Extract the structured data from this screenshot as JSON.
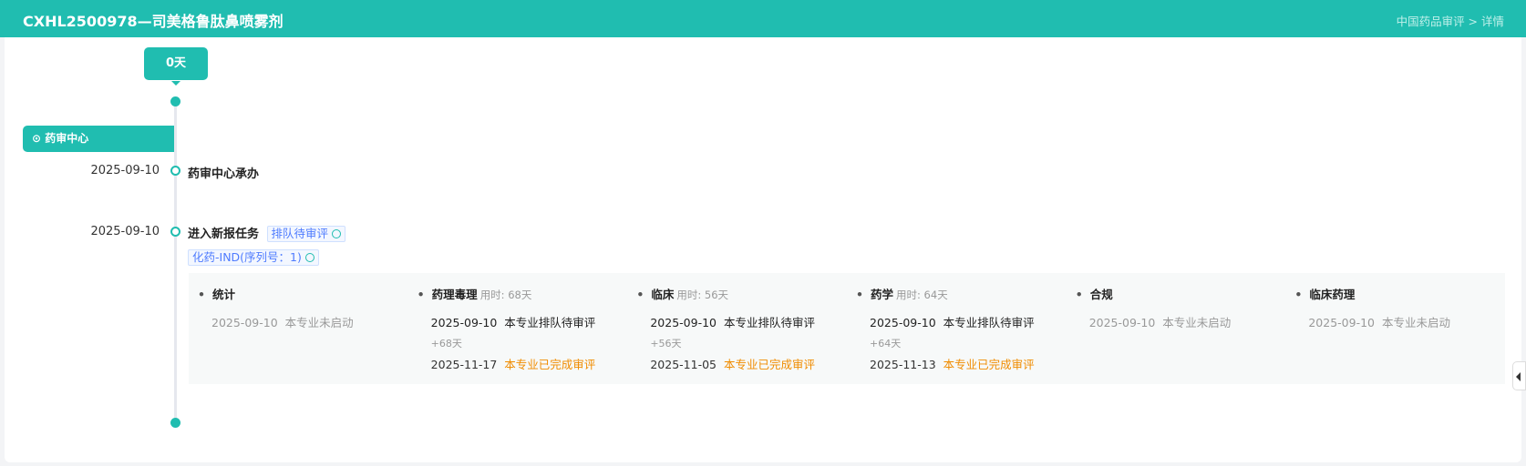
{
  "header": {
    "title": "CXHL2500978—司美格鲁肽鼻喷雾剂",
    "breadcrumb": "中国药品审评 > 详情"
  },
  "timeline": {
    "days": "0天",
    "location": "药审中心",
    "events": [
      {
        "date": "2025-09-10",
        "title": "药审中心承办"
      },
      {
        "date": "2025-09-10",
        "title": "进入新报任务",
        "tag": "排队待审评",
        "sub_tag": "化药-IND(序列号：1)"
      }
    ]
  },
  "specialties": [
    {
      "name": "统计",
      "used": "",
      "lines": [
        {
          "date": "2025-09-10",
          "status": "本专业未启动"
        }
      ]
    },
    {
      "name": "药理毒理",
      "used": "用时: 68天",
      "lines": [
        {
          "date": "2025-09-10",
          "status": "本专业排队待审评"
        }
      ],
      "delta": "+68天",
      "end": {
        "date": "2025-11-17",
        "status": "本专业已完成审评"
      }
    },
    {
      "name": "临床",
      "used": "用时: 56天",
      "lines": [
        {
          "date": "2025-09-10",
          "status": "本专业排队待审评"
        }
      ],
      "delta": "+56天",
      "end": {
        "date": "2025-11-05",
        "status": "本专业已完成审评"
      }
    },
    {
      "name": "药学",
      "used": "用时: 64天",
      "lines": [
        {
          "date": "2025-09-10",
          "status": "本专业排队待审评"
        }
      ],
      "delta": "+64天",
      "end": {
        "date": "2025-11-13",
        "status": "本专业已完成审评"
      }
    },
    {
      "name": "合规",
      "used": "",
      "lines": [
        {
          "date": "2025-09-10",
          "status": "本专业未启动"
        }
      ]
    },
    {
      "name": "临床药理",
      "used": "",
      "lines": [
        {
          "date": "2025-09-10",
          "status": "本专业未启动"
        }
      ]
    }
  ]
}
